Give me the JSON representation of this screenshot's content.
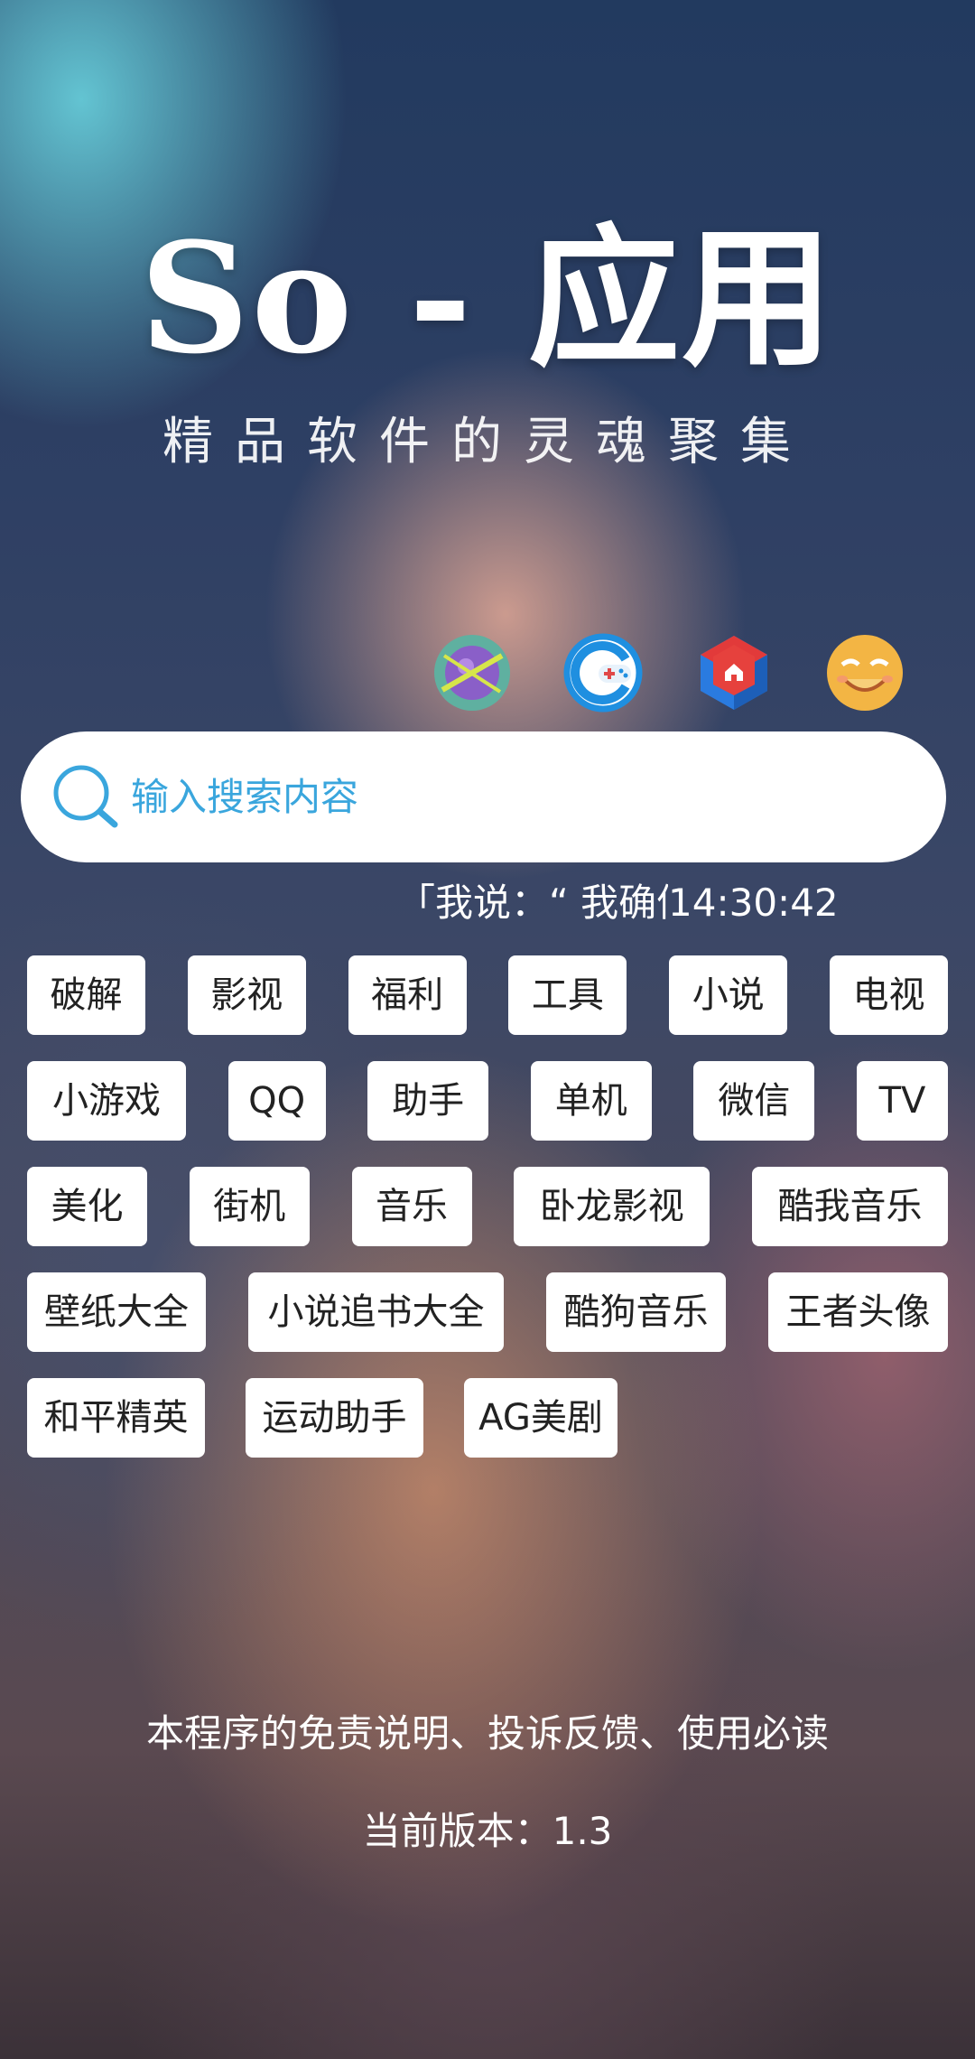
{
  "header": {
    "title": "So - 应用",
    "subtitle": "精品软件的灵魂聚集"
  },
  "quick_icons": [
    {
      "name": "planet-app-icon"
    },
    {
      "name": "game-controller-app-icon"
    },
    {
      "name": "home-cube-app-icon"
    },
    {
      "name": "smiley-face-icon"
    }
  ],
  "search": {
    "placeholder": "输入搜索内容",
    "value": ""
  },
  "ticker": {
    "text": "「我说：“ 我确信 你知",
    "time": "14:30:42"
  },
  "tags": {
    "row1": [
      "破解",
      "影视",
      "福利",
      "工具",
      "小说",
      "电视"
    ],
    "row2": [
      "小游戏",
      "QQ",
      "助手",
      "单机",
      "微信",
      "TV"
    ],
    "row3": [
      "美化",
      "街机",
      "音乐",
      "卧龙影视",
      "酷我音乐"
    ],
    "row4": [
      "壁纸大全",
      "小说追书大全",
      "酷狗音乐",
      "王者头像"
    ],
    "row5": [
      "和平精英",
      "运动助手",
      "AG美剧"
    ]
  },
  "footer": {
    "notice_link": "本程序的免责说明、投诉反馈、使用必读",
    "version": "当前版本：1.3"
  },
  "colors": {
    "search_accent": "#3aa6dd",
    "tag_background": "#ffffff",
    "text_light": "#ffffff"
  }
}
